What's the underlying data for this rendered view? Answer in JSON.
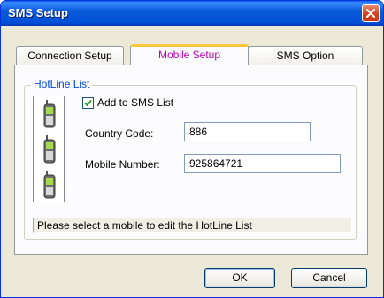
{
  "window": {
    "title": "SMS Setup",
    "close_icon": "close-icon"
  },
  "tabs": [
    {
      "label": "Connection Setup",
      "active": false
    },
    {
      "label": "Mobile Setup",
      "active": true
    },
    {
      "label": "SMS Option",
      "active": false
    }
  ],
  "hotline": {
    "legend": "HotLine List",
    "phone_icon": "mobile-phone-icon",
    "phone_count": 3,
    "add_to_list": {
      "label": "Add to SMS List",
      "checked": true
    },
    "country_code": {
      "label": "Country Code:",
      "value": "886"
    },
    "mobile_number": {
      "label": "Mobile Number:",
      "value": "925864721"
    },
    "status_text": "Please select a mobile to edit the HotLine List"
  },
  "buttons": {
    "ok": "OK",
    "cancel": "Cancel"
  },
  "colors": {
    "titlebar": "#0050d8",
    "active_tab_text": "#b600b6",
    "legend_text": "#0046d5",
    "tab_highlight": "#ffc83c",
    "close_button": "#d3431f"
  }
}
